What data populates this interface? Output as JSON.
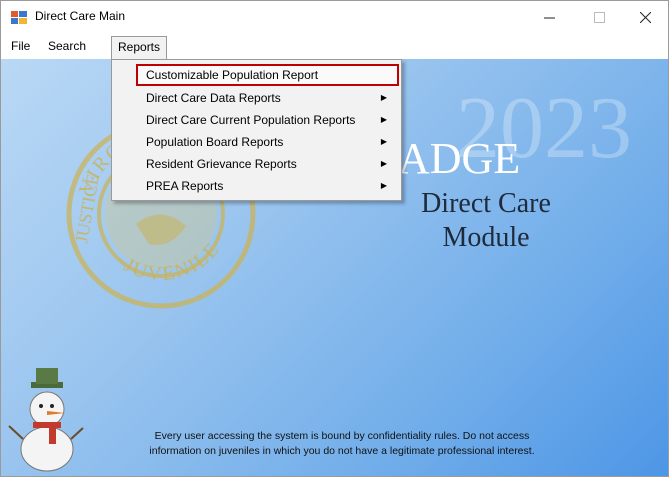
{
  "window": {
    "title": "Direct Care Main",
    "controls": {
      "minimize": "—",
      "maximize": "☐",
      "close": "✕"
    }
  },
  "menubar": {
    "items": [
      {
        "label": "File"
      },
      {
        "label": "Search"
      },
      {
        "label": "Reports",
        "open": true
      }
    ]
  },
  "reports_menu": {
    "items": [
      {
        "label": "Customizable Population Report",
        "highlighted": true,
        "submenu": false
      },
      {
        "label": "Direct Care Data Reports",
        "submenu": true
      },
      {
        "label": "Direct Care Current Population Reports",
        "submenu": true
      },
      {
        "label": "Population Board Reports",
        "submenu": true
      },
      {
        "label": "Resident Grievance Reports",
        "submenu": true
      },
      {
        "label": "PREA Reports",
        "submenu": true
      }
    ],
    "submenu_arrow": "▶"
  },
  "splash": {
    "year": "2023",
    "product": "ADGE",
    "module_line1": "Direct Care",
    "module_line2": "Module",
    "seal_text_top": "VIRGINIA DEPARTMENT OF",
    "seal_text_left": "JUSTICE",
    "seal_text_bottom": "JUVENILE"
  },
  "notice": "Every user accessing the system is bound by confidentiality rules. Do not access information on juveniles in which you do not have a legitimate professional interest.",
  "colors": {
    "highlight_border": "#c00000",
    "seal_gold": "#c9b35a",
    "background_light": "#b9d8f5",
    "background_dark": "#4d96e6"
  }
}
